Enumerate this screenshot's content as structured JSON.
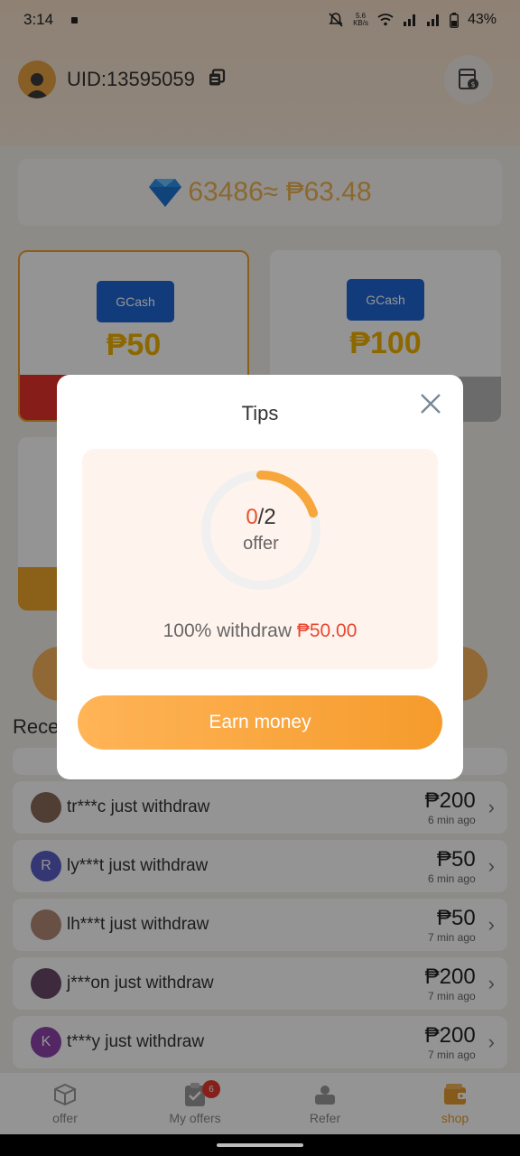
{
  "status_bar": {
    "time": "3:14",
    "net_speed_top": "5.6",
    "net_speed_unit": "KB/s",
    "battery": "43%"
  },
  "header": {
    "uid": "UID:13595059"
  },
  "balance": {
    "text": "63486≈ ₱63.48"
  },
  "withdraw_options": [
    {
      "brand": "GCash",
      "amount": "₱50",
      "selected": true
    },
    {
      "brand": "GCash",
      "amount": "₱100",
      "selected": false
    }
  ],
  "recent": {
    "title": "Rece",
    "items": [
      {
        "text": "tr***c just withdraw",
        "amount": "₱200",
        "time": "6 min ago"
      },
      {
        "text": "ly***t just withdraw",
        "amount": "₱50",
        "time": "6 min ago",
        "initial": "R"
      },
      {
        "text": "lh***t just withdraw",
        "amount": "₱50",
        "time": "7 min ago"
      },
      {
        "text": "j***on just withdraw",
        "amount": "₱200",
        "time": "7 min ago"
      },
      {
        "text": "t***y just withdraw",
        "amount": "₱200",
        "time": "7 min ago",
        "initial": "K"
      }
    ]
  },
  "tabbar": {
    "tabs": [
      {
        "label": "offer",
        "icon": "box-icon"
      },
      {
        "label": "My offers",
        "icon": "clipboard-check-icon",
        "badge": "6"
      },
      {
        "label": "Refer",
        "icon": "refer-icon"
      },
      {
        "label": "shop",
        "icon": "wallet-icon",
        "active": true
      }
    ]
  },
  "modal": {
    "title": "Tips",
    "progress": {
      "done": "0",
      "total": "/2",
      "label": "offer",
      "fraction_shown": 0.2
    },
    "withdraw_prefix": "100% withdraw",
    "withdraw_amount": "₱50.00",
    "button_label": "Earn money"
  },
  "colors": {
    "accent": "#f59b2c",
    "gcash_blue": "#1f66d6",
    "money_red": "#e8472f",
    "amount_yellow": "#f3b400"
  }
}
